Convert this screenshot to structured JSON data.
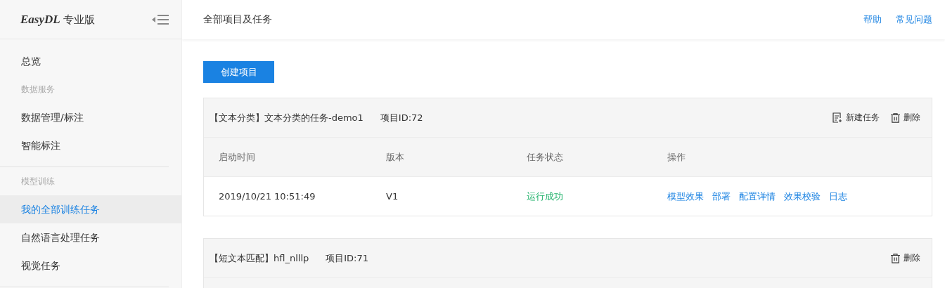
{
  "sidebar": {
    "logo": {
      "brand": "EasyDL",
      "edition": "专业版"
    },
    "sections": [
      {
        "items": [
          {
            "label": "总览",
            "selected": false
          }
        ]
      },
      {
        "heading": "数据服务",
        "items": [
          {
            "label": "数据管理/标注",
            "selected": false
          },
          {
            "label": "智能标注",
            "selected": false
          }
        ]
      },
      {
        "heading": "模型训练",
        "items": [
          {
            "label": "我的全部训练任务",
            "selected": true
          },
          {
            "label": "自然语言处理任务",
            "selected": false
          },
          {
            "label": "视觉任务",
            "selected": false
          }
        ]
      }
    ]
  },
  "header": {
    "title": "全部项目及任务",
    "links": [
      "帮助",
      "常见问题"
    ]
  },
  "create_button": "创建项目",
  "projects": [
    {
      "title": "【文本分类】文本分类的任务-demo1",
      "project_id": "项目ID:72",
      "actions": [
        {
          "kind": "new-task",
          "label": "新建任务"
        },
        {
          "kind": "delete",
          "label": "删除"
        }
      ],
      "table": {
        "columns": [
          "启动时间",
          "版本",
          "任务状态",
          "操作"
        ],
        "rows": [
          {
            "start_time": "2019/10/21 10:51:49",
            "version": "V1",
            "status": "运行成功",
            "operations": [
              "模型效果",
              "部署",
              "配置详情",
              "效果校验",
              "日志"
            ]
          }
        ]
      }
    },
    {
      "title": "【短文本匹配】hfl_nlllp",
      "project_id": "项目ID:71",
      "actions": [
        {
          "kind": "delete",
          "label": "删除"
        }
      ]
    }
  ]
}
